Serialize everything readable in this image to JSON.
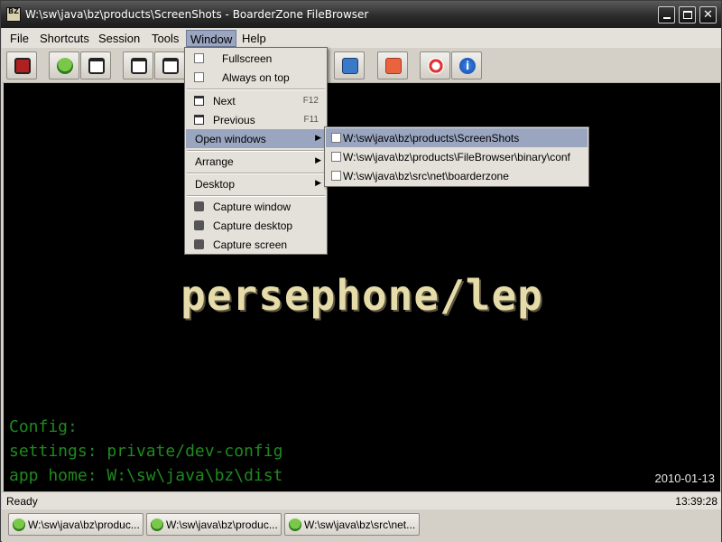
{
  "window": {
    "title": "W:\\sw\\java\\bz\\products\\ScreenShots - BoarderZone FileBrowser",
    "icon_text": "BZ"
  },
  "menubar": {
    "items": [
      {
        "label": "File",
        "mnemonic": "F"
      },
      {
        "label": "Shortcuts",
        "mnemonic": "c"
      },
      {
        "label": "Session",
        "mnemonic": "S"
      },
      {
        "label": "Tools",
        "mnemonic": "T"
      },
      {
        "label": "Window",
        "mnemonic": "W"
      },
      {
        "label": "Help",
        "mnemonic": "H"
      }
    ],
    "active": "Window"
  },
  "toolbar": {
    "buttons": [
      {
        "name": "exit-icon"
      },
      {
        "name": "tree-icon"
      },
      {
        "name": "window-icon"
      },
      {
        "name": "window-icon"
      },
      {
        "name": "window-icon"
      },
      {
        "name": "info-icon"
      },
      {
        "name": "power-icon"
      },
      {
        "name": "lifebuoy-icon"
      },
      {
        "name": "about-icon"
      }
    ]
  },
  "window_menu": {
    "fullscreen": "Fullscreen",
    "always_on_top": "Always on top",
    "next": "Next",
    "next_accel": "F12",
    "previous": "Previous",
    "previous_accel": "F11",
    "open_windows": "Open windows",
    "arrange": "Arrange",
    "desktop": "Desktop",
    "capture_window": "Capture window",
    "capture_desktop": "Capture desktop",
    "capture_screen": "Capture screen"
  },
  "open_windows_submenu": {
    "items": [
      "W:\\sw\\java\\bz\\products\\ScreenShots",
      "W:\\sw\\java\\bz\\products\\FileBrowser\\binary\\conf",
      "W:\\sw\\java\\bz\\src\\net\\boarderzone"
    ]
  },
  "content": {
    "hostname": "persephone/lep",
    "config_label": "Config:",
    "settings_line": "settings: private/dev-config",
    "app_home_line": "app home: W:\\sw\\java\\bz\\dist",
    "date": "2010-01-13",
    "colors": {
      "background": "#000000",
      "hostname": "#e6dcaa",
      "config_text": "#1f8a1f"
    }
  },
  "statusbar": {
    "status": "Ready",
    "time": "13:39:28"
  },
  "taskbar": {
    "tasks": [
      "W:\\sw\\java\\bz\\produc...",
      "W:\\sw\\java\\bz\\produc...",
      "W:\\sw\\java\\bz\\src\\net..."
    ]
  }
}
